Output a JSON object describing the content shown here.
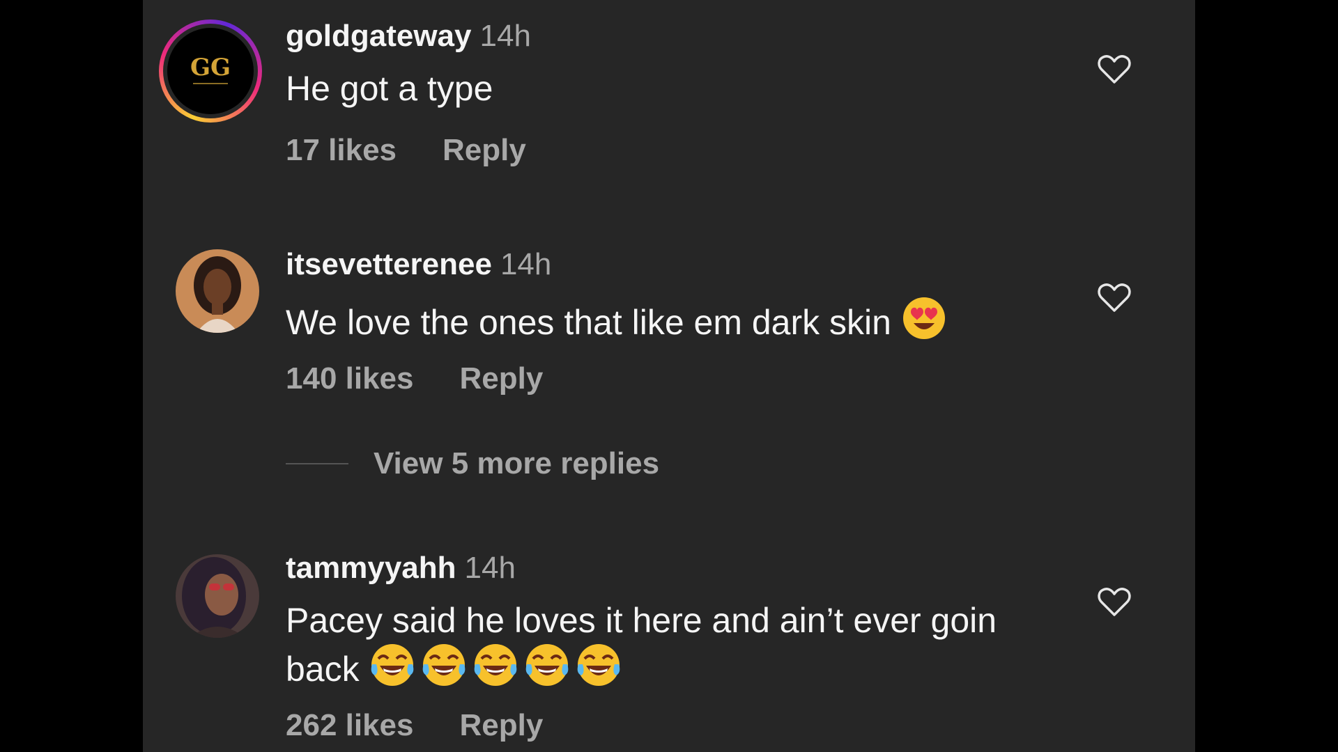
{
  "colors": {
    "background": "#000000",
    "panel": "#262626",
    "primary_text": "#f5f5f5",
    "secondary_text": "#a8a8a8",
    "story_ring": [
      "#f9ce34",
      "#ee2a7b",
      "#6228d7"
    ]
  },
  "comments": [
    {
      "username": "goldgateway",
      "time": "14h",
      "text": "He got a type",
      "emojis": [],
      "likes": "17 likes",
      "reply_label": "Reply",
      "avatar": "gold-gateway-logo",
      "avatar_logo_text": "GG",
      "has_story_ring": true,
      "heart_icon": "heart-outline-icon"
    },
    {
      "username": "itsevetterenee",
      "time": "14h",
      "text": "We love the ones that like em dark skin",
      "emojis": [
        "heart-eyes-emoji"
      ],
      "likes": "140 likes",
      "reply_label": "Reply",
      "avatar": "user-photo",
      "has_story_ring": false,
      "heart_icon": "heart-outline-icon"
    },
    {
      "username": "tammyyahh",
      "time": "14h",
      "text": "Pacey said he loves it here and ain’t ever goin back",
      "emojis": [
        "tears-of-joy-emoji",
        "tears-of-joy-emoji",
        "tears-of-joy-emoji",
        "tears-of-joy-emoji",
        "tears-of-joy-emoji"
      ],
      "likes": "262 likes",
      "reply_label": "Reply",
      "avatar": "user-photo",
      "has_story_ring": false,
      "heart_icon": "heart-outline-icon"
    }
  ],
  "view_more_replies": "View 5 more replies"
}
